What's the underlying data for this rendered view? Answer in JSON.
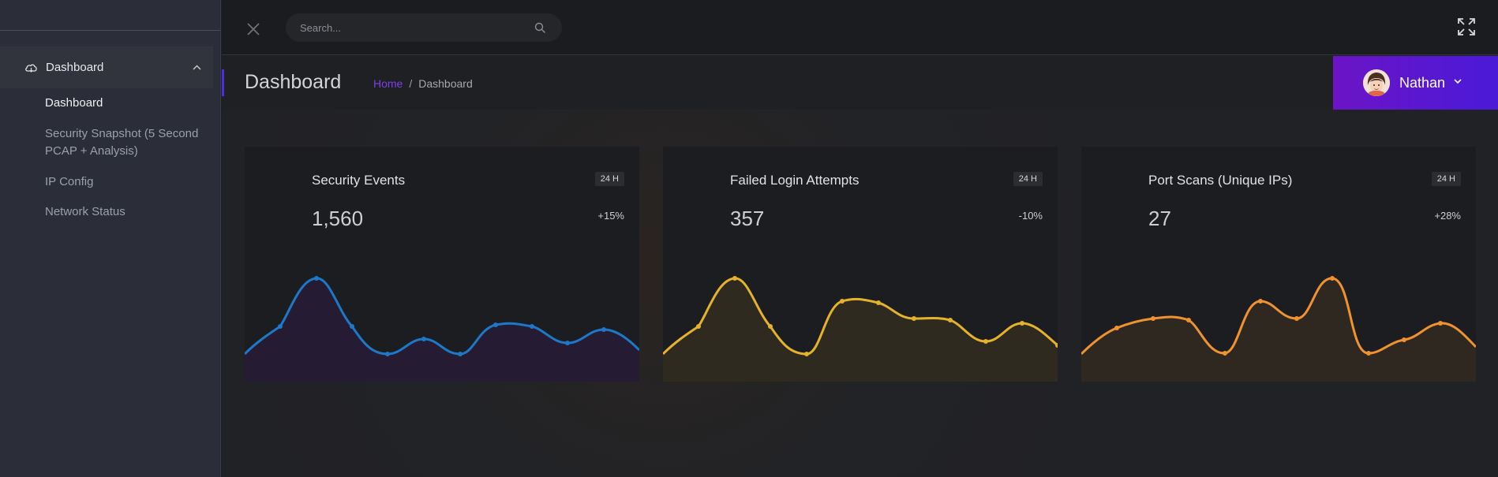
{
  "sidebar": {
    "group_label": "Dashboard",
    "group_icon": "cloud-icon",
    "items": [
      {
        "label": "Dashboard",
        "active": true
      },
      {
        "label": "Security Snapshot (5 Second PCAP + Analysis)",
        "active": false
      },
      {
        "label": "IP Config",
        "active": false
      },
      {
        "label": "Network Status",
        "active": false
      }
    ]
  },
  "topbar": {
    "search_placeholder": "Search..."
  },
  "header": {
    "title": "Dashboard",
    "breadcrumb": {
      "home": "Home",
      "separator": "/",
      "current": "Dashboard"
    },
    "user": {
      "name": "Nathan"
    }
  },
  "colors": {
    "accent": "#7e3fe6",
    "user_gradient_start": "#6c14c6",
    "user_gradient_end": "#4a1ad8"
  },
  "cards": [
    {
      "title": "Security Events",
      "badge": "24 H",
      "value": "1,560",
      "change": "+15%",
      "color": "#1e78c8",
      "fill": "#251c33"
    },
    {
      "title": "Failed Login Attempts",
      "badge": "24 H",
      "value": "357",
      "change": "-10%",
      "color": "#e4b32a",
      "fill": "#2f2a1f"
    },
    {
      "title": "Port Scans (Unique IPs)",
      "badge": "24 H",
      "value": "27",
      "change": "+28%",
      "color": "#f0932e",
      "fill": "#2f2820"
    }
  ]
}
